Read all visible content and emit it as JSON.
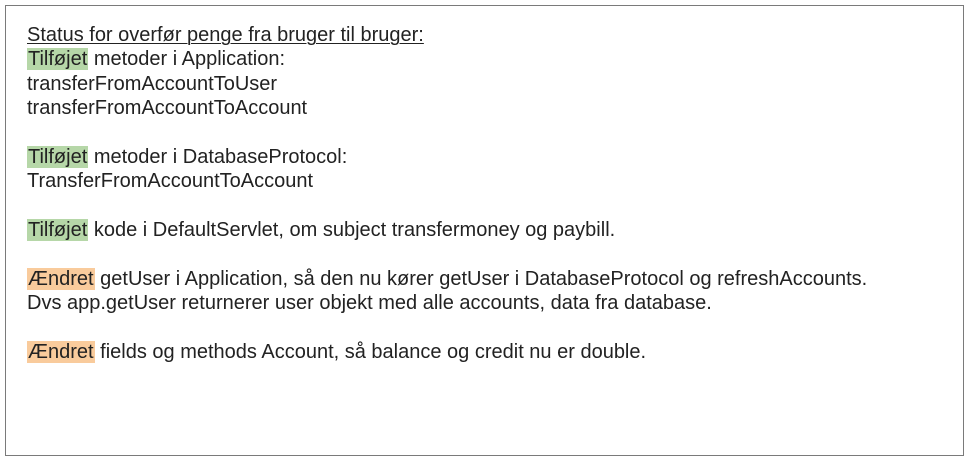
{
  "title": "Status for overfør penge fra bruger til bruger:",
  "colors": {
    "added_highlight": "#b6d7a8",
    "changed_highlight": "#f9cb9c",
    "border": "#7a7a7a",
    "text": "#222222"
  },
  "sections": {
    "application": {
      "tag": "Tilføjet",
      "text": " metoder i Application:",
      "items": [
        "transferFromAccountToUser",
        "transferFromAccountToAccount"
      ]
    },
    "database_protocol": {
      "tag": "Tilføjet",
      "text": " metoder i DatabaseProtocol:",
      "items": [
        "TransferFromAccountToAccount"
      ]
    },
    "default_servlet": {
      "tag": "Tilføjet",
      "text": " kode i DefaultServlet, om subject transfermoney og paybill."
    },
    "get_user": {
      "tag": "Ændret",
      "text": " getUser i Application, så den nu kører getUser i DatabaseProtocol og refreshAccounts.",
      "continuation": "Dvs app.getUser returnerer user objekt med alle accounts, data fra database."
    },
    "account_fields": {
      "tag": "Ændret",
      "text": " fields og methods Account, så balance og credit nu er double."
    }
  }
}
